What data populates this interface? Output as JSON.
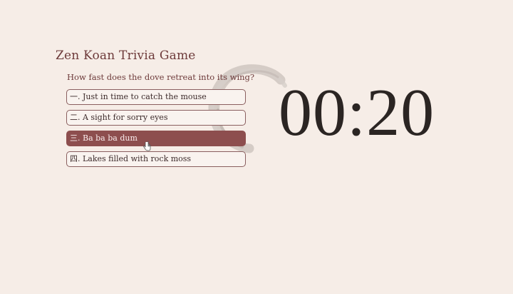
{
  "game": {
    "title": "Zen Koan Trivia Game",
    "question": "How fast does the dove retreat into its wing?",
    "answers": [
      {
        "numeral": "一",
        "text": ". Just in time to catch the mouse",
        "selected": false
      },
      {
        "numeral": "二",
        "text": ". A sight for sorry eyes",
        "selected": false
      },
      {
        "numeral": "三",
        "text": ". Ba ba ba dum",
        "selected": true
      },
      {
        "numeral": "四",
        "text": ". Lakes filled with rock moss",
        "selected": false
      }
    ],
    "timer": "00:20"
  },
  "icons": {
    "background": "enso-circle-icon",
    "pointer": "hand-cursor-icon"
  },
  "colors": {
    "background": "#f6ede7",
    "accent": "#8d4e4e",
    "title": "#6d3a3a",
    "timer": "#2b2523"
  }
}
